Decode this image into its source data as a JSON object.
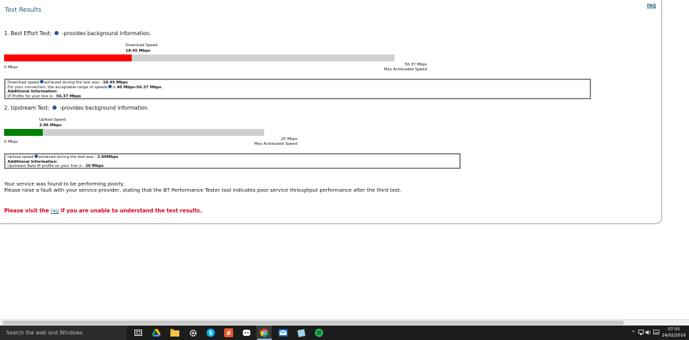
{
  "panel": {
    "title": "Test Results",
    "faq_link": "FAQ"
  },
  "download_test": {
    "heading_prefix": "1. Best Effort Test:",
    "heading_suffix": "-provides background information.",
    "speed_label": "Download Speed",
    "speed_value": "18.45 Mbps",
    "min_label": "0 Mbps",
    "max_value": "56.37 Mbps",
    "max_label": "Max Achievable Speed",
    "fill_color": "#ff0000",
    "fill_fraction": 0.327,
    "box": {
      "line1_prefix": "Download speed",
      "line1_mid": "achieved during the test was -",
      "line1_value": "18.45 Mbps",
      "line2_prefix": "For your connection, the acceptable range of speeds",
      "line2_mid": "is",
      "line2_value": "40 Mbps-56.37 Mbps",
      "line2_suffix": ".",
      "additional_heading": "Additional Information:",
      "line4_text": "IP Profile for your line is -",
      "line4_value": "56.37 Mbps"
    }
  },
  "upload_test": {
    "heading_prefix": "2. Upstream Test:",
    "heading_suffix": "-provides background information.",
    "speed_label": "Upload Speed",
    "speed_value": "2.96 Mbps",
    "min_label": "0 Mbps",
    "max_value": "20 Mbps",
    "max_label": "Max Achievable Speed",
    "fill_color": "#008000",
    "fill_fraction": 0.148,
    "box": {
      "line1_prefix": "Upload speed",
      "line1_mid": "achieved during the test was -",
      "line1_value": "2.96Mbps",
      "additional_heading": "Additional Information:",
      "line3_text": "Upstream Rate IP profile on your line is -",
      "line3_value": "20 Mbps"
    }
  },
  "summary": {
    "line1": "Your service was found to be performing poorly.",
    "line2": "Please raise a fault with your service provider, stating that the BT Performance Tester tool indicates poor service throughput performance after the third test."
  },
  "faq_notice": {
    "prefix": "Please visit the",
    "link": "FAQ",
    "suffix": "if you are unable to understand the test results."
  },
  "taskbar": {
    "search_placeholder": "Search the web and Windows",
    "icons": [
      "task-view-icon",
      "google-drive-icon",
      "file-explorer-icon",
      "settings-icon",
      "skype-icon",
      "slack-icon",
      "discord-icon",
      "chrome-icon",
      "outlook-icon",
      "notes-icon",
      "spotify-icon"
    ],
    "clock_time": "07:55",
    "clock_date": "24/02/2016"
  }
}
